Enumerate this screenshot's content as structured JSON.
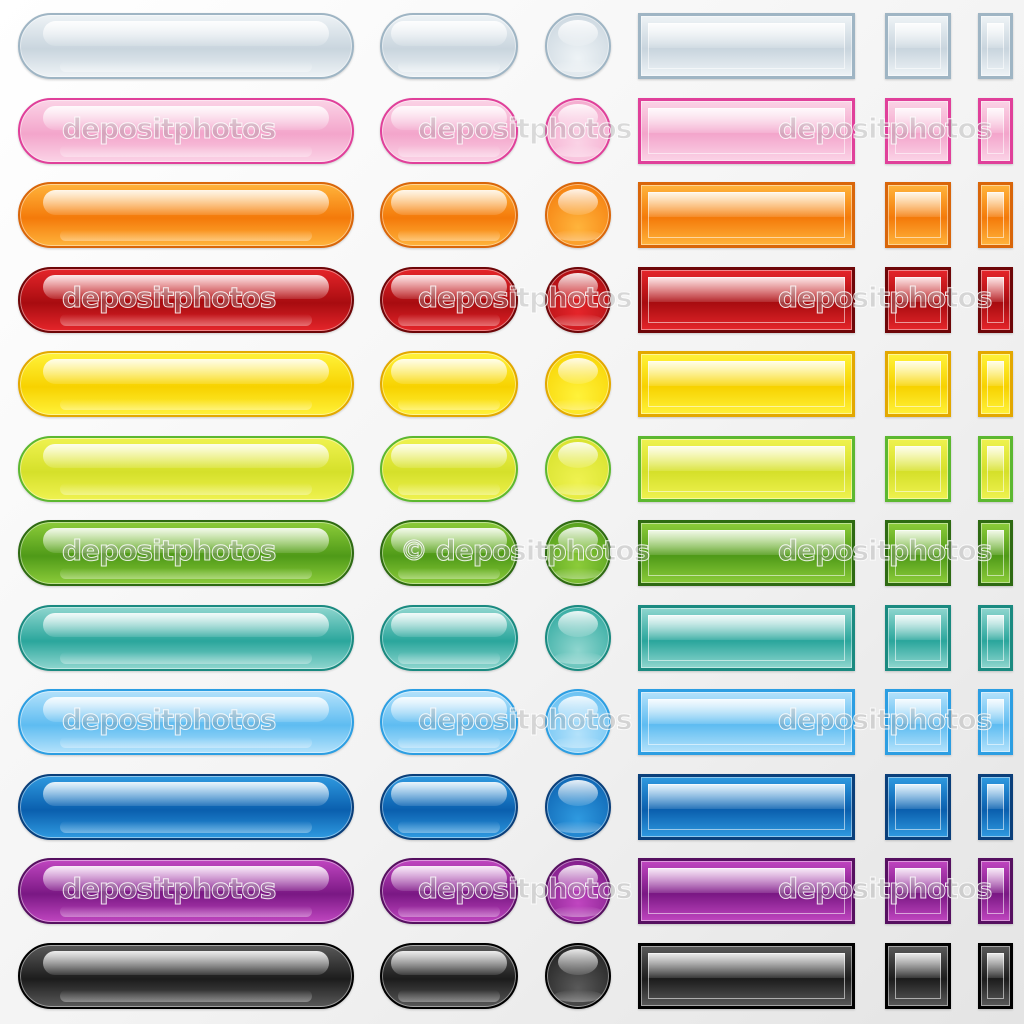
{
  "watermark": {
    "text": "depositphotos",
    "text_with_mark": "© depositphotos"
  },
  "button_rows": [
    {
      "name": "white",
      "fill": "#eef3f6",
      "fill_dark": "#c9d5de",
      "border": "#9fb5c4"
    },
    {
      "name": "pink",
      "fill": "#fbd3e6",
      "fill_dark": "#f3a5cb",
      "border": "#e0409a"
    },
    {
      "name": "orange",
      "fill": "#ffb43c",
      "fill_dark": "#f47a0a",
      "border": "#d9660a"
    },
    {
      "name": "red",
      "fill": "#e5252a",
      "fill_dark": "#a80c10",
      "border": "#6e0608"
    },
    {
      "name": "yellow",
      "fill": "#fff23a",
      "fill_dark": "#f7d200",
      "border": "#e3a800"
    },
    {
      "name": "lime",
      "fill": "#eff250",
      "fill_dark": "#d5e02a",
      "border": "#5cb830"
    },
    {
      "name": "green",
      "fill": "#8ccc3a",
      "fill_dark": "#4f9a18",
      "border": "#2e6a12"
    },
    {
      "name": "teal",
      "fill": "#8fd6cf",
      "fill_dark": "#2aa69c",
      "border": "#1a8a80"
    },
    {
      "name": "light-blue",
      "fill": "#b4e2fb",
      "fill_dark": "#5ebcf1",
      "border": "#2c9ee2"
    },
    {
      "name": "blue",
      "fill": "#2f9ae0",
      "fill_dark": "#0a5fae",
      "border": "#0a3f7a"
    },
    {
      "name": "purple",
      "fill": "#c046c0",
      "fill_dark": "#7a1884",
      "border": "#561060"
    },
    {
      "name": "black",
      "fill": "#5a5a5a",
      "fill_dark": "#1c1c1c",
      "border": "#000000"
    }
  ]
}
